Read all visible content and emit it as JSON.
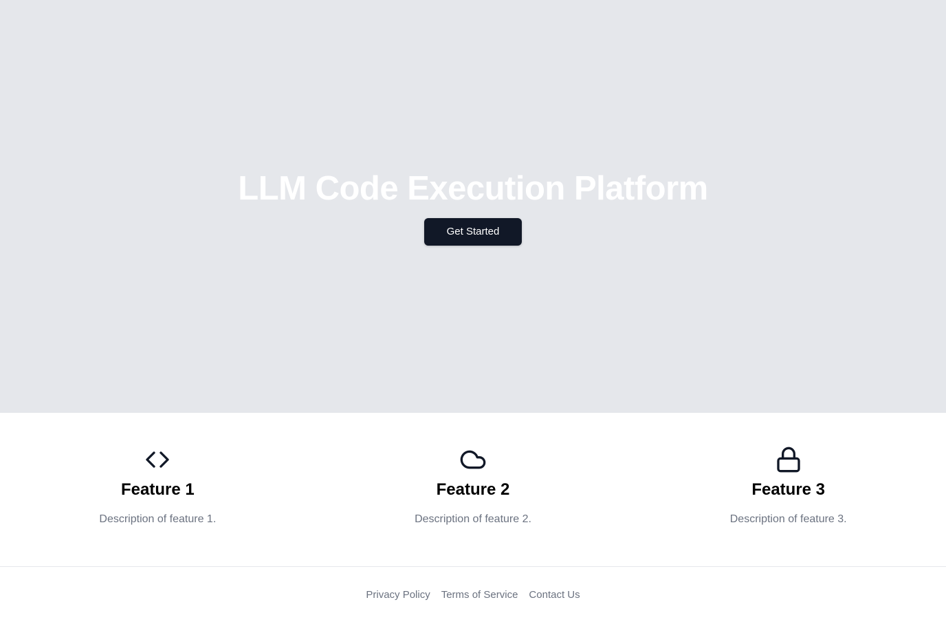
{
  "hero": {
    "title": "LLM Code Execution Platform",
    "cta_label": "Get Started"
  },
  "features": [
    {
      "icon": "code-icon",
      "title": "Feature 1",
      "description": "Description of feature 1."
    },
    {
      "icon": "cloud-icon",
      "title": "Feature 2",
      "description": "Description of feature 2."
    },
    {
      "icon": "lock-icon",
      "title": "Feature 3",
      "description": "Description of feature 3."
    }
  ],
  "footer": {
    "links": [
      "Privacy Policy",
      "Terms of Service",
      "Contact Us"
    ]
  },
  "colors": {
    "hero_bg": "#e5e7eb",
    "button_bg": "#111827",
    "muted_text": "#6b7280"
  }
}
